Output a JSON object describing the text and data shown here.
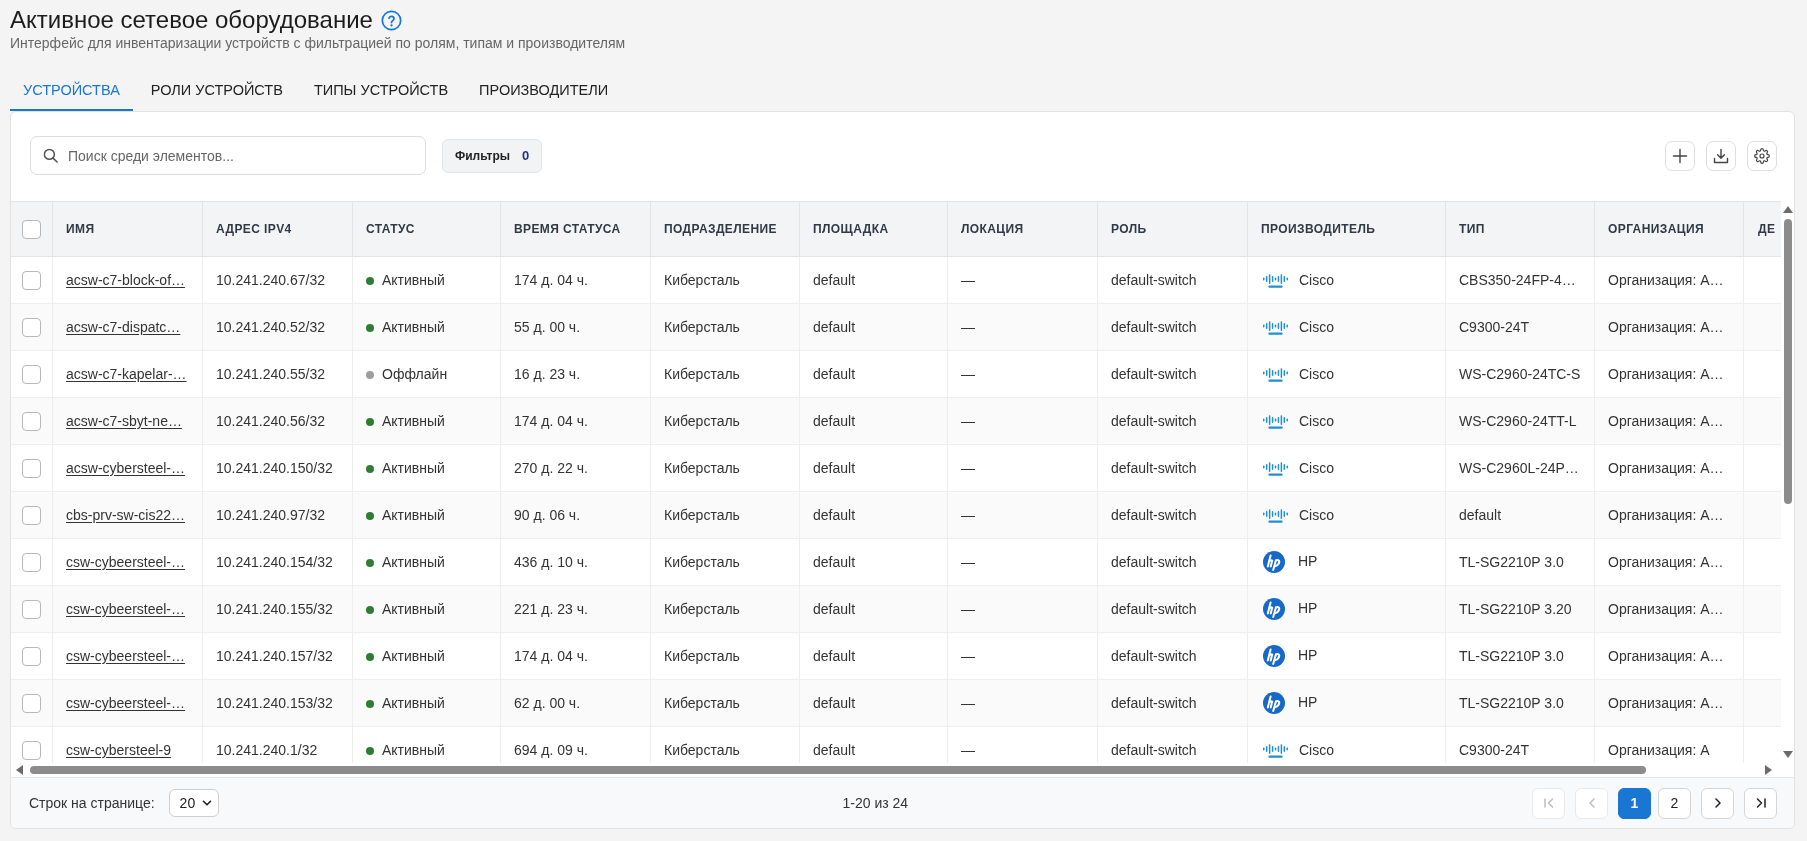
{
  "page": {
    "title": "Активное сетевое оборудование",
    "subtitle": "Интерфейс для инвентаризации устройств с фильтрацией по ролям, типам и производителям"
  },
  "tabs": [
    {
      "label": "УСТРОЙСТВА",
      "selected": true
    },
    {
      "label": "РОЛИ УСТРОЙСТВ",
      "selected": false
    },
    {
      "label": "ТИПЫ УСТРОЙСТВ",
      "selected": false
    },
    {
      "label": "ПРОИЗВОДИТЕЛИ",
      "selected": false
    }
  ],
  "toolbar": {
    "search": {
      "placeholder": "Поиск среди элементов..."
    },
    "filters": {
      "label": "Фильтры",
      "count": "0"
    }
  },
  "table": {
    "select_all": {
      "checked": false
    },
    "columns": [
      "ИМЯ",
      "АДРЕС IPV4",
      "СТАТУС",
      "ВРЕМЯ СТАТУСА",
      "ПОДРАЗДЕЛЕНИЕ",
      "ПЛОЩАДКА",
      "ЛОКАЦИЯ",
      "РОЛЬ",
      "ПРОИЗВОДИТЕЛЬ",
      "ТИП",
      "ОРГАНИЗАЦИЯ",
      "ДЕ"
    ],
    "rows": [
      {
        "checked": false,
        "name": "acsw-c7-block-of…",
        "ipv4": "10.241.240.67/32",
        "status": {
          "text": "Активный",
          "color": "#2e7d32"
        },
        "status_time": "174 д. 04 ч.",
        "division": "Киберсталь",
        "site": "default",
        "location": "—",
        "role": "default-switch",
        "vendor": {
          "kind": "cisco",
          "name": "Cisco"
        },
        "type": "CBS350-24FP-4…",
        "organization": "Организация: А…"
      },
      {
        "checked": false,
        "name": "acsw-c7-dispatc…",
        "ipv4": "10.241.240.52/32",
        "status": {
          "text": "Активный",
          "color": "#2e7d32"
        },
        "status_time": "55 д. 00 ч.",
        "division": "Киберсталь",
        "site": "default",
        "location": "—",
        "role": "default-switch",
        "vendor": {
          "kind": "cisco",
          "name": "Cisco"
        },
        "type": "C9300-24T",
        "organization": "Организация: А…"
      },
      {
        "checked": false,
        "name": "acsw-c7-kapelar-…",
        "ipv4": "10.241.240.55/32",
        "status": {
          "text": "Оффлайн",
          "color": "#9e9e9e"
        },
        "status_time": "16 д. 23 ч.",
        "division": "Киберсталь",
        "site": "default",
        "location": "—",
        "role": "default-switch",
        "vendor": {
          "kind": "cisco",
          "name": "Cisco"
        },
        "type": "WS-C2960-24TC-S",
        "organization": "Организация: А…"
      },
      {
        "checked": false,
        "name": "acsw-c7-sbyt-ne…",
        "ipv4": "10.241.240.56/32",
        "status": {
          "text": "Активный",
          "color": "#2e7d32"
        },
        "status_time": "174 д. 04 ч.",
        "division": "Киберсталь",
        "site": "default",
        "location": "—",
        "role": "default-switch",
        "vendor": {
          "kind": "cisco",
          "name": "Cisco"
        },
        "type": "WS-C2960-24TT-L",
        "organization": "Организация: А…"
      },
      {
        "checked": false,
        "name": "acsw-cybersteel-…",
        "ipv4": "10.241.240.150/32",
        "status": {
          "text": "Активный",
          "color": "#2e7d32"
        },
        "status_time": "270 д. 22 ч.",
        "division": "Киберсталь",
        "site": "default",
        "location": "—",
        "role": "default-switch",
        "vendor": {
          "kind": "cisco",
          "name": "Cisco"
        },
        "type": "WS-C2960L-24P…",
        "organization": "Организация: А…"
      },
      {
        "checked": false,
        "name": "cbs-prv-sw-cis22…",
        "ipv4": "10.241.240.97/32",
        "status": {
          "text": "Активный",
          "color": "#2e7d32"
        },
        "status_time": "90 д. 06 ч.",
        "division": "Киберсталь",
        "site": "default",
        "location": "—",
        "role": "default-switch",
        "vendor": {
          "kind": "cisco",
          "name": "Cisco"
        },
        "type": "default",
        "organization": "Организация: А…"
      },
      {
        "checked": false,
        "name": "csw-cybeersteel-…",
        "ipv4": "10.241.240.154/32",
        "status": {
          "text": "Активный",
          "color": "#2e7d32"
        },
        "status_time": "436 д. 10 ч.",
        "division": "Киберсталь",
        "site": "default",
        "location": "—",
        "role": "default-switch",
        "vendor": {
          "kind": "hp",
          "name": "HP"
        },
        "type": "TL-SG2210P 3.0",
        "organization": "Организация: А…"
      },
      {
        "checked": false,
        "name": "csw-cybeersteel-…",
        "ipv4": "10.241.240.155/32",
        "status": {
          "text": "Активный",
          "color": "#2e7d32"
        },
        "status_time": "221 д. 23 ч.",
        "division": "Киберсталь",
        "site": "default",
        "location": "—",
        "role": "default-switch",
        "vendor": {
          "kind": "hp",
          "name": "HP"
        },
        "type": "TL-SG2210P 3.20",
        "organization": "Организация: А…"
      },
      {
        "checked": false,
        "name": "csw-cybeersteel-…",
        "ipv4": "10.241.240.157/32",
        "status": {
          "text": "Активный",
          "color": "#2e7d32"
        },
        "status_time": "174 д. 04 ч.",
        "division": "Киберсталь",
        "site": "default",
        "location": "—",
        "role": "default-switch",
        "vendor": {
          "kind": "hp",
          "name": "HP"
        },
        "type": "TL-SG2210P 3.0",
        "organization": "Организация: А…"
      },
      {
        "checked": false,
        "name": "csw-cybeersteel-…",
        "ipv4": "10.241.240.153/32",
        "status": {
          "text": "Активный",
          "color": "#2e7d32"
        },
        "status_time": "62 д. 00 ч.",
        "division": "Киберсталь",
        "site": "default",
        "location": "—",
        "role": "default-switch",
        "vendor": {
          "kind": "hp",
          "name": "HP"
        },
        "type": "TL-SG2210P 3.0",
        "organization": "Организация: А…"
      },
      {
        "checked": false,
        "name": "csw-cybersteel-9",
        "ipv4": "10.241.240.1/32",
        "status": {
          "text": "Активный",
          "color": "#2e7d32"
        },
        "status_time": "694 д. 09 ч.",
        "division": "Киберсталь",
        "site": "default",
        "location": "—",
        "role": "default-switch",
        "vendor": {
          "kind": "cisco",
          "name": "Cisco"
        },
        "type": "C9300-24T",
        "organization": "Организация: А"
      }
    ]
  },
  "footer": {
    "rows_label": "Строк на странице:",
    "rows_per_page": "20",
    "range": "1-20 из 24",
    "nav_before": [
      {
        "kind": "first",
        "disabled": true
      },
      {
        "kind": "prev",
        "disabled": true
      }
    ],
    "pages": [
      {
        "label": "1",
        "selected": true
      },
      {
        "label": "2",
        "selected": false
      }
    ],
    "nav_after": [
      {
        "kind": "next",
        "disabled": false
      },
      {
        "kind": "last",
        "disabled": false
      }
    ]
  }
}
